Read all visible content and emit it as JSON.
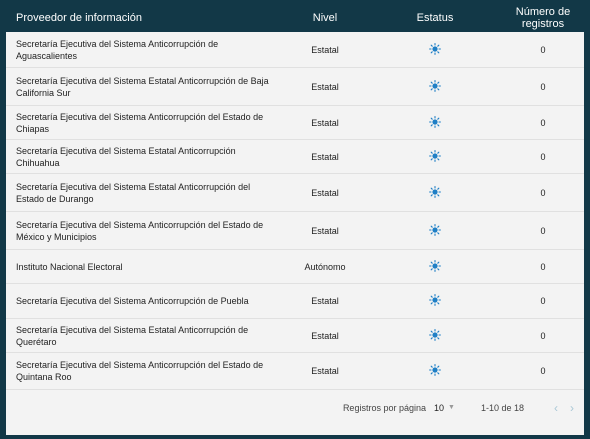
{
  "table": {
    "headers": {
      "provider": "Proveedor de información",
      "level": "Nivel",
      "status": "Estatus",
      "count": "Número de registros"
    },
    "rows": [
      {
        "provider": "Secretaría Ejecutiva del Sistema Anticorrupción de Aguascalientes",
        "level": "Estatal",
        "status_icon": "sun-icon",
        "count": "0"
      },
      {
        "provider": "Secretaría Ejecutiva del Sistema Estatal Anticorrupción de Baja California Sur",
        "level": "Estatal",
        "status_icon": "sun-icon",
        "count": "0"
      },
      {
        "provider": "Secretaría Ejecutiva del Sistema Anticorrupción del Estado de Chiapas",
        "level": "Estatal",
        "status_icon": "sun-icon",
        "count": "0"
      },
      {
        "provider": "Secretaría Ejecutiva del Sistema Estatal Anticorrupción Chihuahua",
        "level": "Estatal",
        "status_icon": "sun-icon",
        "count": "0"
      },
      {
        "provider": "Secretaría Ejecutiva del Sistema Estatal Anticorrupción del Estado de Durango",
        "level": "Estatal",
        "status_icon": "sun-icon",
        "count": "0"
      },
      {
        "provider": "Secretaría Ejecutiva del Sistema Anticorrupción del Estado de México y Municipios",
        "level": "Estatal",
        "status_icon": "sun-icon",
        "count": "0"
      },
      {
        "provider": "Instituto Nacional Electoral",
        "level": "Autónomo",
        "status_icon": "sun-icon",
        "count": "0"
      },
      {
        "provider": "Secretaría Ejecutiva del Sistema Anticorrupción de Puebla",
        "level": "Estatal",
        "status_icon": "sun-icon",
        "count": "0"
      },
      {
        "provider": "Secretaría Ejecutiva del Sistema Estatal Anticorrupción de Querétaro",
        "level": "Estatal",
        "status_icon": "sun-icon",
        "count": "0"
      },
      {
        "provider": "Secretaría Ejecutiva del Sistema Anticorrupción del Estado de Quintana Roo",
        "level": "Estatal",
        "status_icon": "sun-icon",
        "count": "0"
      }
    ]
  },
  "pagination": {
    "rows_per_page_label": "Registros por página",
    "rows_per_page_value": "10",
    "range": "1-10 de 18"
  },
  "colors": {
    "header_bg": "#123847",
    "status_icon": "#1f7fc6",
    "nav_arrow": "#aac8d6"
  }
}
